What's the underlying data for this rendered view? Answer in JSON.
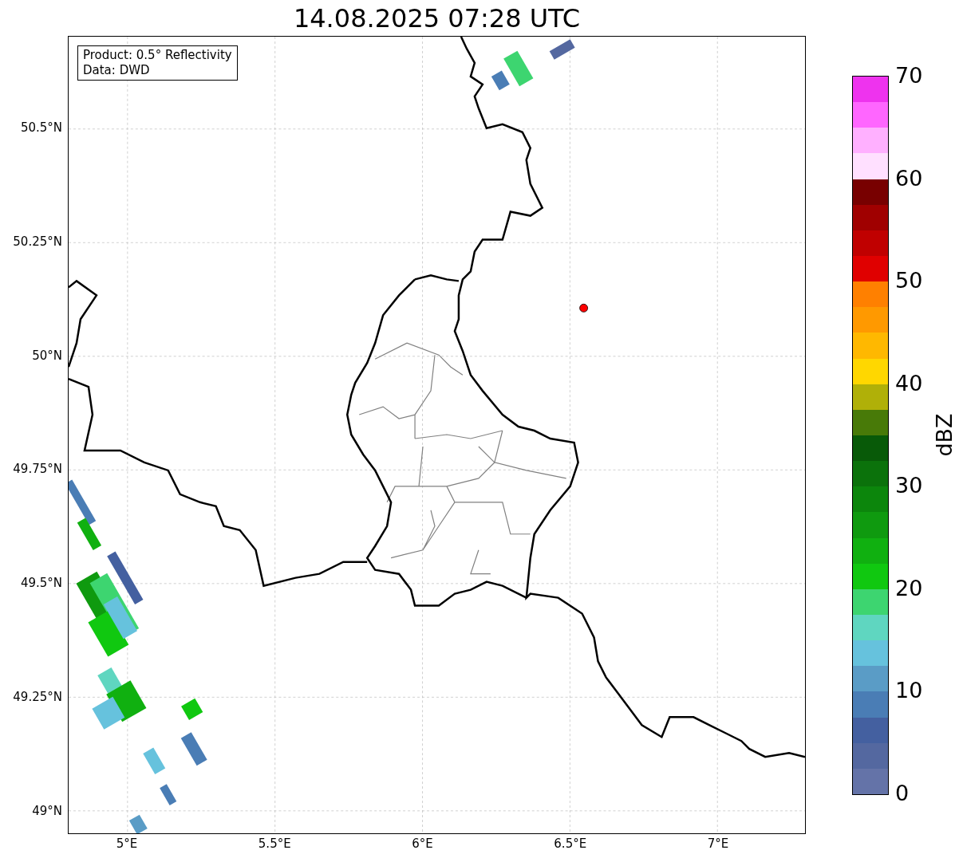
{
  "title": "14.08.2025 07:28 UTC",
  "info_box": [
    "Product: 0.5° Reflectivity",
    "Data: DWD"
  ],
  "map": {
    "lat_labels": [
      "50.5°N",
      "50.25°N",
      "50°N",
      "49.75°N",
      "49.5°N",
      "49.25°N",
      "49°N"
    ],
    "lon_labels": [
      "5°E",
      "5.5°E",
      "6°E",
      "6.5°E",
      "7°E"
    ]
  },
  "colorbar": {
    "label": "dBZ",
    "ticks": [
      "70",
      "60",
      "50",
      "40",
      "30",
      "20",
      "10",
      "0"
    ],
    "bins": [
      {
        "color": "#6473a8"
      },
      {
        "color": "#5468a0"
      },
      {
        "color": "#4460a0"
      },
      {
        "color": "#4a7db5"
      },
      {
        "color": "#5a9cc6"
      },
      {
        "color": "#66c2dd"
      },
      {
        "color": "#5fd6c0"
      },
      {
        "color": "#3dd570"
      },
      {
        "color": "#10c810"
      },
      {
        "color": "#10b010"
      },
      {
        "color": "#0f9a0f"
      },
      {
        "color": "#0c860c"
      },
      {
        "color": "#0b720b"
      },
      {
        "color": "#085a08"
      },
      {
        "color": "#487a08"
      },
      {
        "color": "#b0b008"
      },
      {
        "color": "#ffd700"
      },
      {
        "color": "#ffb800"
      },
      {
        "color": "#ff9900"
      },
      {
        "color": "#ff8000"
      },
      {
        "color": "#e00000"
      },
      {
        "color": "#c00000"
      },
      {
        "color": "#a00000"
      },
      {
        "color": "#780000"
      },
      {
        "color": "#ffe0ff"
      },
      {
        "color": "#ffb0ff"
      },
      {
        "color": "#ff66ff"
      },
      {
        "color": "#ee33ee"
      }
    ]
  }
}
